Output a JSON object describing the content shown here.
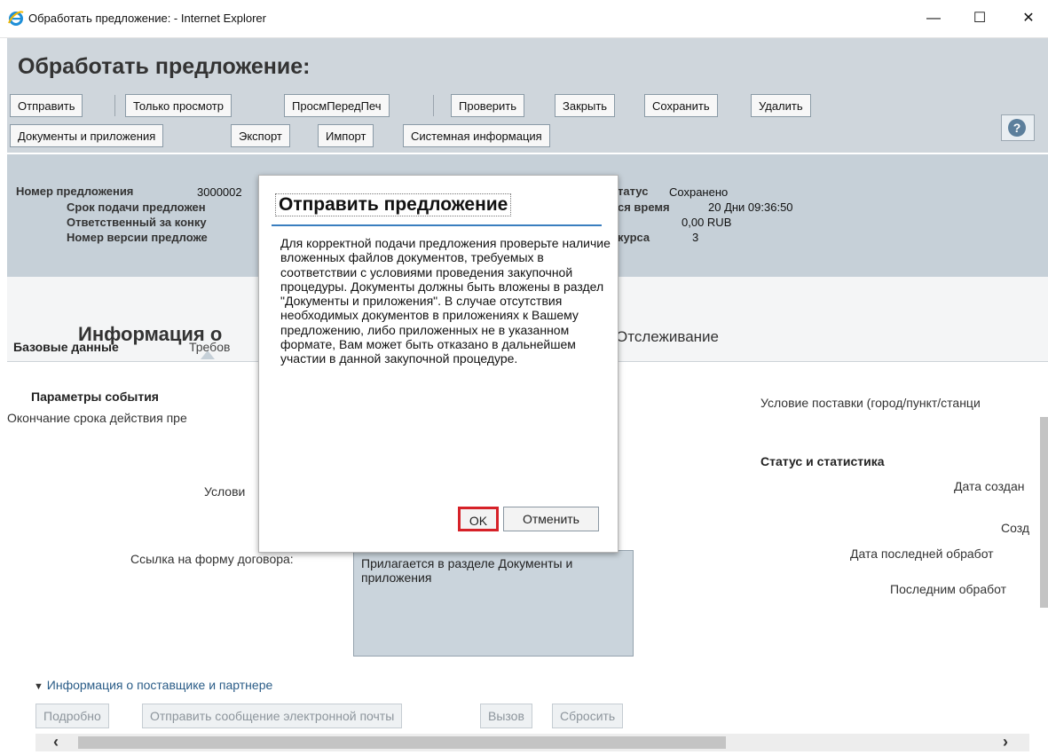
{
  "window": {
    "title": "Обработать предложение: - Internet Explorer",
    "minimize": "—",
    "maximize": "☐",
    "close": "✕"
  },
  "page": {
    "title": "Обработать предложение:"
  },
  "toolbar": {
    "row1": [
      "Отправить",
      "Только просмотр",
      "ПросмПередПеч",
      "Проверить",
      "Закрыть",
      "Сохранить",
      "Удалить"
    ],
    "row2": [
      "Документы и приложения",
      "Экспорт",
      "Импорт",
      "Системная информация"
    ],
    "help": "?"
  },
  "info": {
    "left_labels": [
      "Номер предложения",
      "Срок подачи предложен",
      "Ответственный за конку",
      "Номер версии предложе"
    ],
    "number_value": "3000002",
    "right_labels": [
      "татус",
      "ся время",
      "курса"
    ],
    "status_value": "Сохранено",
    "time_value": "20 Дни 09:36:50",
    "amount_value": "0,00 RUB",
    "version_value": "3"
  },
  "tabs": {
    "active": "Информация о",
    "tracking": "Отслеживание",
    "sub_basic": "Базовые данные",
    "sub_req": "Требов"
  },
  "form": {
    "params_title": "Параметры события",
    "deadline_label": "Окончание срока действия пре",
    "conditions_label": "Услови",
    "contract_label": "Ссылка на форму договора:",
    "contract_value": "Прилагается в разделе Документы и приложения",
    "delivery_label": "Условие поставки (город/пункт/станци",
    "status_title": "Статус и статистика",
    "created_date": "Дата создан",
    "created_by": "Созд",
    "last_date": "Дата последней обработ",
    "last_by": "Последним обработ"
  },
  "partner": {
    "expander": "Информация о поставщике и партнере",
    "buttons": [
      "Подробно",
      "Отправить сообщение электронной почты",
      "Вызов",
      "Сбросить"
    ]
  },
  "dialog": {
    "title": "Отправить предложение",
    "message": "Для корректной подачи предложения проверьте наличие вложенных файлов документов, требуемых в соответствии с условиями проведения закупочной процедуры. Документы должны быть вложены в раздел \"Документы и приложения\". В случае отсутствия необходимых документов в приложениях к Вашему предложению, либо приложенных не в указанном формате, Вам может быть отказано в дальнейшем участии в данной закупочной процедуре.",
    "ok": "OK",
    "cancel": "Отменить"
  },
  "colors": {
    "header_bg": "#cfd6dc",
    "info_bg": "#c6d0d8",
    "accent_blue": "#3a7ebf",
    "ok_border": "#d62128"
  },
  "icons": [
    "ie-logo-icon",
    "help-icon",
    "triangle-down-icon",
    "scroll-left-icon",
    "scroll-right-icon"
  ]
}
